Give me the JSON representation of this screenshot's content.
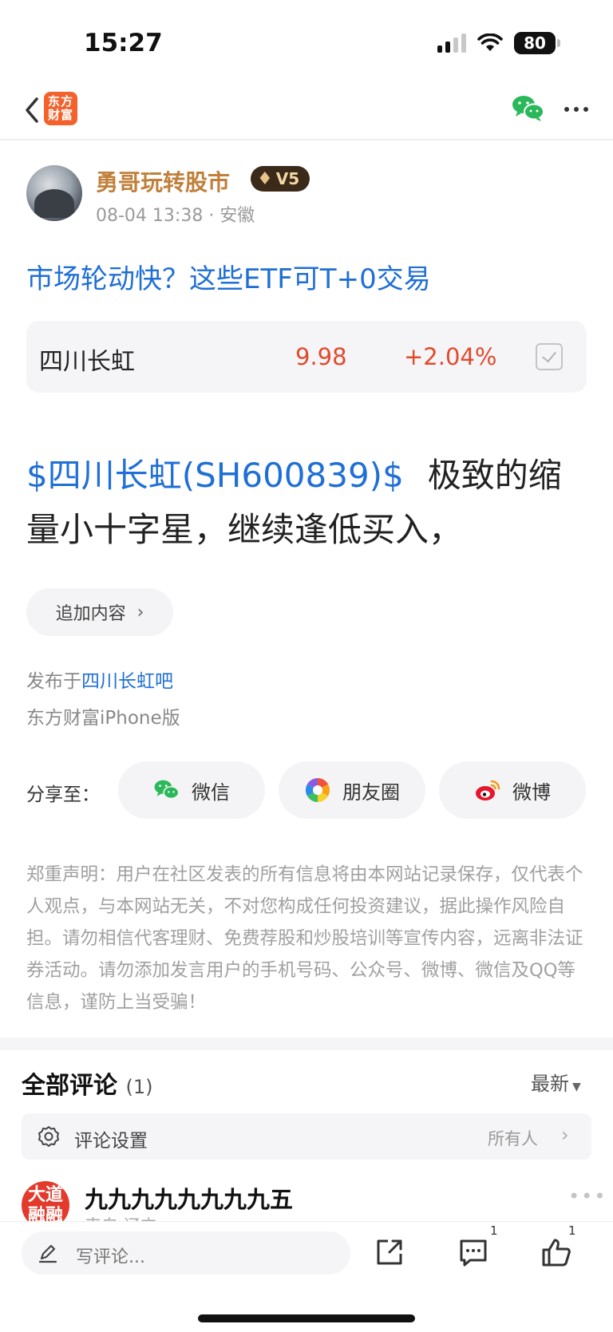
{
  "status_bar": {
    "time": "15:27",
    "battery": "80",
    "icons": [
      "signal-icon",
      "wifi-icon",
      "battery-icon"
    ]
  },
  "nav": {
    "back_icon": "chevron-left-icon",
    "logo_text": "东方财富",
    "logo_color": "#f3622d",
    "wechat_icon": "wechat-icon",
    "more_icon": "more-horizontal-icon"
  },
  "author": {
    "name": "勇哥玩转股市",
    "level": "V5",
    "meta": "08-04 13:38 · 安徽",
    "name_color": "#c0803b"
  },
  "post": {
    "title": "市场轮动快？这些ETF可T+0交易",
    "stock": {
      "name": "四川长虹",
      "price": "9.98",
      "change": "+2.04%",
      "color": "#e24a2c"
    },
    "body_link": "$四川长虹(SH600839)$",
    "body_text": "极致的缩量小十字星，继续逢低买入，",
    "append_label": "追加内容",
    "published_prefix": "发布于",
    "published_bar": "四川长虹吧",
    "client": "东方财富iPhone版",
    "link_color": "#1f6fd6"
  },
  "share": {
    "label": "分享至：",
    "buttons": [
      {
        "label": "微信",
        "icon": "wechat-icon"
      },
      {
        "label": "朋友圈",
        "icon": "moments-icon"
      },
      {
        "label": "微博",
        "icon": "weibo-icon"
      }
    ]
  },
  "disclaimer": "郑重声明：用户在社区发表的所有信息将由本网站记录保存，仅代表个人观点，与本网站无关，不对您构成任何投资建议，据此操作风险自担。请勿相信代客理财、免费荐股和炒股培训等宣传内容，远离非法证券活动。请勿添加发言用户的手机号码、公众号、微博、微信及QQ等信息，谨防上当受骗！",
  "comments": {
    "heading": "全部评论",
    "count": "(1)",
    "sort": "最新",
    "settings_label": "评论设置",
    "settings_value": "所有人",
    "items": [
      {
        "avatar_text": "大道融融",
        "user": "九九九九九九九九五",
        "location": "来自 辽宁"
      }
    ]
  },
  "bottom_bar": {
    "placeholder": "写评论...",
    "comment_count": "1",
    "like_count": "1"
  }
}
